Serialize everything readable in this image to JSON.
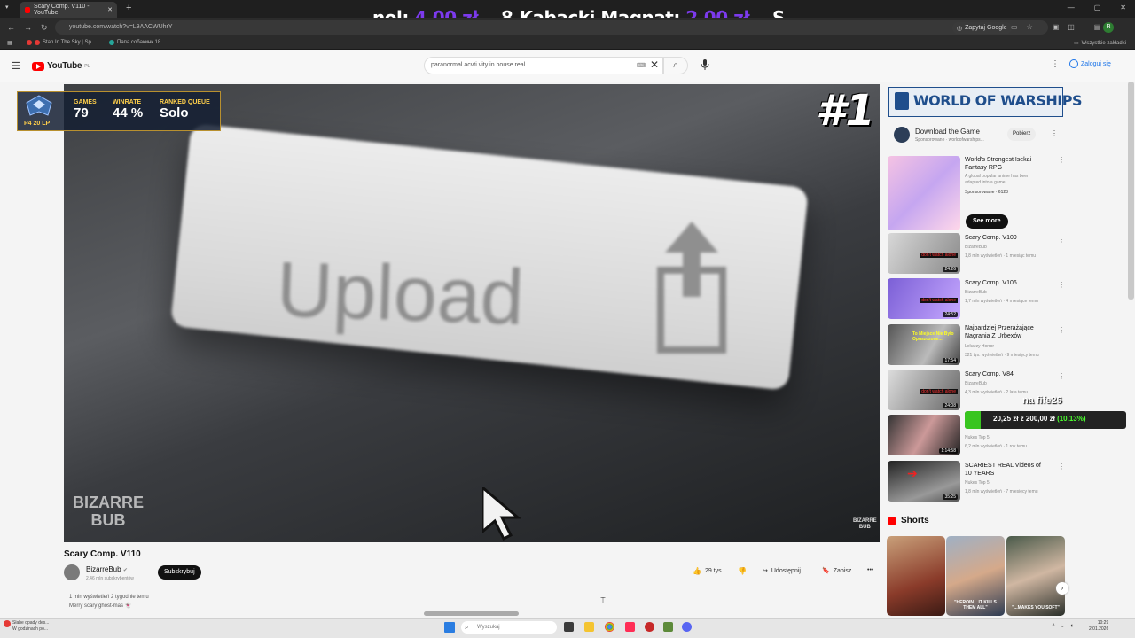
{
  "browser": {
    "tab_title": "Scary Comp. V110 - YouTube",
    "tab_close": "✕",
    "new_tab": "+",
    "url": "youtube.com/watch?v=L9AACWUhrY",
    "ask_google": "Zapytaj Google",
    "profile_initial": "R",
    "bookmarks": [
      "Stan In The Sky | Sp...",
      "Папа собакинк 18..."
    ],
    "all_bookmarks": "Wszystkie zakładki"
  },
  "ticker": {
    "prefix": "nol: ",
    "prefix_amount": "4,00 zł",
    "entry": "8.Kabacki Magnat: ",
    "entry_amount": "2.00 zł",
    "tail": "S",
    "accent": "#7c3aed"
  },
  "youtube": {
    "logo_text": "YouTube",
    "logo_sup": "PL",
    "search_value": "paranormal acvti vity in house real",
    "signin": "Zaloguj się"
  },
  "video": {
    "screen_text": "Upload",
    "rank_badge": "#1",
    "watermark_line1": "BIZARRE",
    "watermark_line2": "BUB",
    "small_watermark1": "BIZARRE",
    "small_watermark2": "BUB",
    "title": "Scary Comp. V110",
    "channel": "BizarreBub",
    "subs": "2,46 mln subskrybentów",
    "subscribe": "Subskrybuj",
    "likes": "29 tys.",
    "share": "Udostępnij",
    "save": "Zapisz",
    "desc_line1": "1 mln wyświetleń  2 tygodnie temu",
    "desc_line2": "Merry scary ghost-mas 👻"
  },
  "overlay": {
    "rank": "P4 20 LP",
    "games_label": "GAMES",
    "games_value": "79",
    "winrate_label": "WINRATE",
    "winrate_value": "44 %",
    "queue_label": "RANKED QUEUE",
    "queue_value": "Solo"
  },
  "ad": {
    "banner": "WORLD OF WARSHIPS",
    "title": "Download the Game",
    "sponsor": "Sponsorowane · worldofwarships...",
    "button": "Pobierz"
  },
  "recommended": [
    {
      "title": "World's Strongest Isekai Fantasy RPG",
      "meta1": "A global popular anime has been adapted into a game",
      "meta2": "Sponsorowane · 6123",
      "duration": ""
    },
    {
      "title": "Scary Comp. V109",
      "meta1": "BizarreBub",
      "meta2": "1,8 mln wyświetleń · 1 miesiąc temu",
      "duration": "24:26"
    },
    {
      "title": "Scary Comp. V106",
      "meta1": "BizarreBub",
      "meta2": "1,7 mln wyświetleń · 4 miesiące temu",
      "duration": "24:52"
    },
    {
      "title": "Najbardziej Przerażające Nagrania Z Urbexów",
      "meta1": "Lekarzy Horror",
      "meta2": "321 tys. wyświetleń · 9 miesięcy temu",
      "duration": "17:54"
    },
    {
      "title": "Scary Comp. V84",
      "meta1": "BizarreBub",
      "meta2": "4,3 mln wyświetleń · 2 lata temu",
      "duration": "24:08"
    },
    {
      "title": "",
      "meta1": "Nukes Top 5",
      "meta2": "6,2 mln wyświetleń · 1 rok temu",
      "duration": "1:14:58"
    },
    {
      "title": "SCARIEST REAL Videos of 10 YEARS",
      "meta1": "Nukes Top 5",
      "meta2": "1,8 mln wyświetleń · 7 miesięcy temu",
      "duration": "35:25"
    }
  ],
  "thumb_labels": {
    "dont_watch": "don't watch alone",
    "urbex": "To Miejsce Nie Było Opuszczone...",
    "see_more": "See more"
  },
  "donation": {
    "name": "na fife26",
    "amount": "20,25 zł",
    "goal_text": " z 200,00 zł ",
    "percent_text": "(10.13%)",
    "progress": 0.1013
  },
  "shorts": {
    "header": "Shorts",
    "captions": [
      "",
      "\"HEROIN... IT KILLS THEM ALL\"",
      "\"...MAKES YOU SOFT\""
    ]
  },
  "taskbar": {
    "weather_line1": "Słabe opady des...",
    "weather_line2": "W godzinach po...",
    "search_placeholder": "Wyszukaj",
    "time": "10:29",
    "date": "2.01.2026"
  },
  "icons": {
    "menu": "☰",
    "search": "⌕",
    "mic": "🎤",
    "kebab": "⋮",
    "next": "›",
    "like": "👍",
    "dislike": "👎",
    "share": "↪",
    "save": "🔖"
  }
}
